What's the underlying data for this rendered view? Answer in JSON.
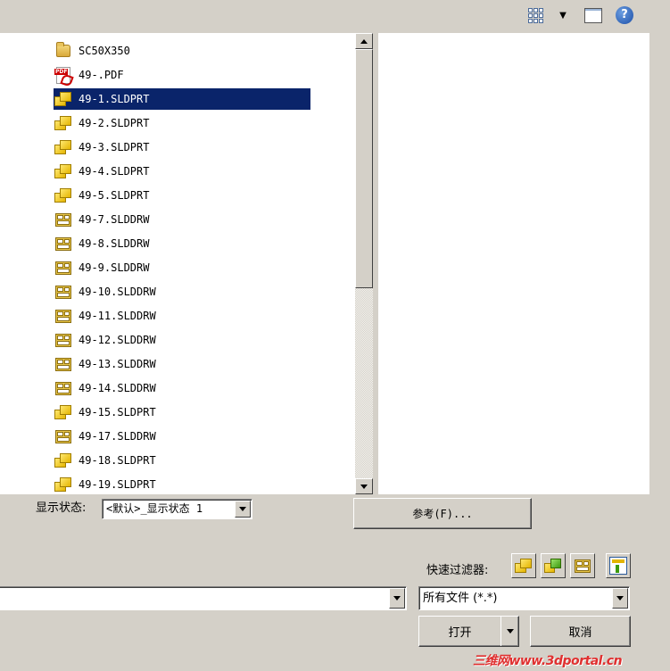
{
  "toolbar": {
    "views_icon": "views-grid-icon",
    "views_dropdown": "chevron-down-icon",
    "preview_icon": "preview-pane-icon",
    "help_icon": "help-icon",
    "help_glyph": "?"
  },
  "file_list": [
    {
      "name": "SC50X350",
      "type": "folder"
    },
    {
      "name": "49-.PDF",
      "type": "pdf"
    },
    {
      "name": "49-1.SLDPRT",
      "type": "part",
      "selected": true
    },
    {
      "name": "49-2.SLDPRT",
      "type": "part"
    },
    {
      "name": "49-3.SLDPRT",
      "type": "part"
    },
    {
      "name": "49-4.SLDPRT",
      "type": "part"
    },
    {
      "name": "49-5.SLDPRT",
      "type": "part"
    },
    {
      "name": "49-7.SLDDRW",
      "type": "drawing"
    },
    {
      "name": "49-8.SLDDRW",
      "type": "drawing"
    },
    {
      "name": "49-9.SLDDRW",
      "type": "drawing"
    },
    {
      "name": "49-10.SLDDRW",
      "type": "drawing"
    },
    {
      "name": "49-11.SLDDRW",
      "type": "drawing"
    },
    {
      "name": "49-12.SLDDRW",
      "type": "drawing"
    },
    {
      "name": "49-13.SLDDRW",
      "type": "drawing"
    },
    {
      "name": "49-14.SLDDRW",
      "type": "drawing"
    },
    {
      "name": "49-15.SLDPRT",
      "type": "part"
    },
    {
      "name": "49-17.SLDDRW",
      "type": "drawing"
    },
    {
      "name": "49-18.SLDPRT",
      "type": "part"
    },
    {
      "name": "49-19.SLDPRT",
      "type": "part"
    }
  ],
  "display_state": {
    "label": "显示状态:",
    "value": "<默认>_显示状态 1"
  },
  "references_button": "参考(F)...",
  "quick_filter": {
    "label": "快速过滤器:",
    "buttons": [
      "filter-parts-icon",
      "filter-assemblies-icon",
      "filter-drawings-icon",
      "filter-top-level-icon"
    ]
  },
  "file_name": {
    "value": ""
  },
  "file_type": {
    "value": "所有文件 (*.*)"
  },
  "open_button": "打开",
  "cancel_button": "取消",
  "watermark": "三维网www.3dportal.cn",
  "colors": {
    "selection": "#0a246a",
    "dialog_bg": "#d4d0c8"
  }
}
